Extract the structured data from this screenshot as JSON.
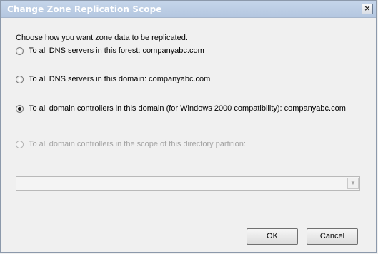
{
  "dialog": {
    "title": "Change Zone Replication Scope",
    "close_glyph": "×"
  },
  "instruction": "Choose how you want zone data to be replicated.",
  "options": [
    {
      "label": "To all DNS servers in this forest: companyabc.com",
      "checked": false,
      "enabled": true
    },
    {
      "label": "To all DNS servers in this domain: companyabc.com",
      "checked": false,
      "enabled": true
    },
    {
      "label": "To all domain controllers in this domain (for Windows 2000 compatibility): companyabc.com",
      "checked": true,
      "enabled": true
    },
    {
      "label": "To all domain controllers in the scope of this directory partition:",
      "checked": false,
      "enabled": false
    }
  ],
  "partition_combo": {
    "value": "",
    "enabled": false,
    "arrow_glyph": "▼"
  },
  "buttons": {
    "ok": "OK",
    "cancel": "Cancel"
  }
}
